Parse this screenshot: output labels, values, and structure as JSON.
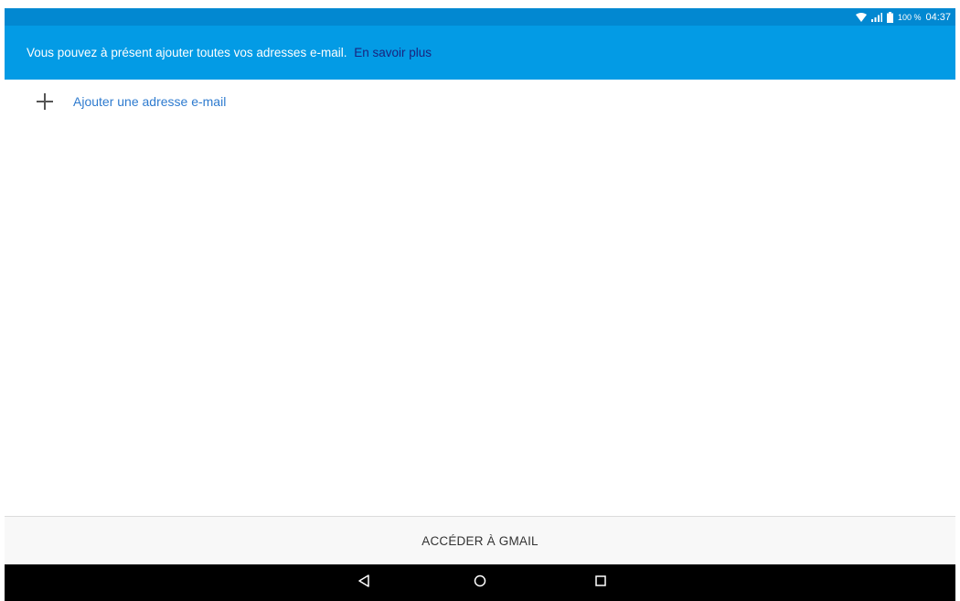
{
  "status_bar": {
    "battery_label": "100 %",
    "time": "04:37",
    "icons": [
      "wifi-icon",
      "signal-icon",
      "battery-icon"
    ]
  },
  "banner": {
    "message": "Vous pouvez à présent ajouter toutes vos adresses e-mail.",
    "link_label": "En savoir plus"
  },
  "add_address": {
    "label": "Ajouter une adresse e-mail",
    "icon": "plus-icon"
  },
  "footer": {
    "button_label": "ACCÉDER À GMAIL"
  },
  "navigation": {
    "buttons": [
      "back-icon",
      "home-icon",
      "recents-icon"
    ]
  },
  "colors": {
    "status_bar": "#0288d1",
    "banner": "#039be5",
    "link": "#1a237e",
    "accent_text": "#2e7bcf",
    "footer_bg": "#f8f8f8",
    "navbar": "#000000"
  }
}
